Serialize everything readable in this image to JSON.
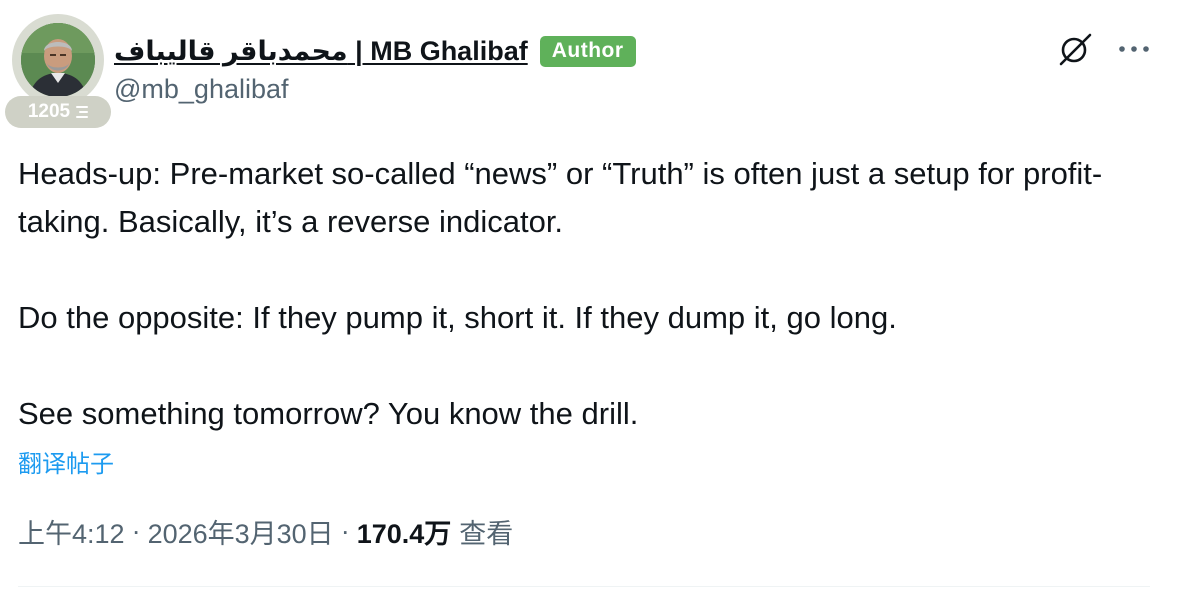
{
  "author": {
    "display_name": "محمدباقر قالیباف | MB Ghalibaf",
    "author_badge": "Author",
    "handle": "@mb_ghalibaf",
    "badge_count": "1205"
  },
  "post": {
    "paragraphs": [
      "Heads-up: Pre-market so-called “news” or “Truth” is often just a setup for profit-taking. Basically, it’s a reverse indicator.",
      "Do the opposite: If they pump it, short it. If they dump it, go long.",
      "See something tomorrow? You know the drill."
    ],
    "translate_label": "翻译帖子"
  },
  "meta": {
    "time": "上午4:12",
    "separator": "·",
    "date": "2026年3月30日",
    "views_count": "170.4万",
    "views_label": "查看"
  },
  "icons": {
    "grok": "grok-slash-icon",
    "more": "more-dots-icon",
    "badge": "lines-icon"
  },
  "colors": {
    "author_badge": "#5fb15a",
    "link": "#1d9bf0",
    "secondary_text": "#536471",
    "primary_text": "#0f1419"
  }
}
